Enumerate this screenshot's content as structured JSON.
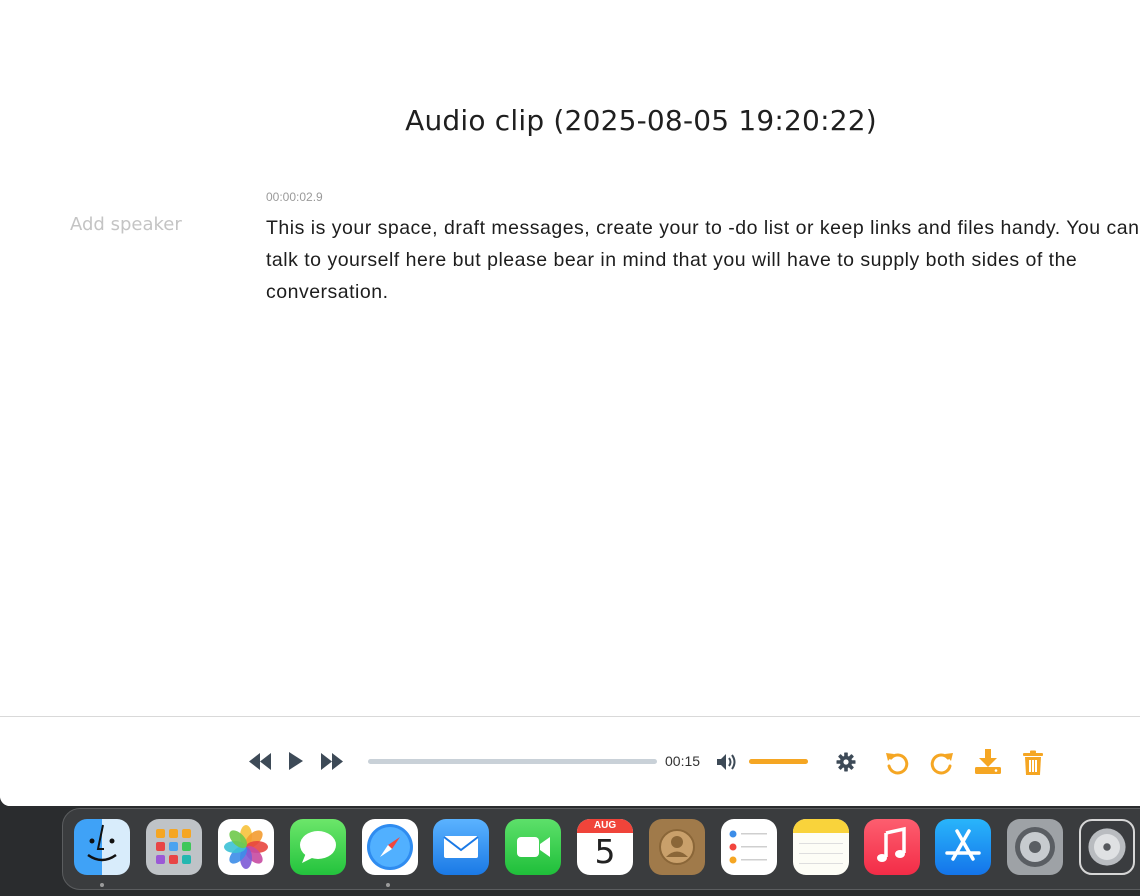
{
  "clip": {
    "title": "Audio clip (2025-08-05 19:20:22)"
  },
  "segment": {
    "speaker_placeholder": "Add speaker",
    "timestamp": "00:00:02.9",
    "text": "This is your space, draft messages, create your to -do list or keep links and files handy. You can talk to yourself here but please bear in mind that you will have to supply both sides of the conversation."
  },
  "player": {
    "time": "00:15",
    "progress": 0,
    "volume": 1.0,
    "accent_color": "#f5a623",
    "icons": [
      "rewind-icon",
      "play-icon",
      "fast-forward-icon",
      "volume-icon",
      "gear-icon",
      "undo-icon",
      "redo-icon",
      "download-icon",
      "trash-icon"
    ]
  },
  "dock": {
    "calendar": {
      "month": "AUG",
      "day": "5"
    },
    "apps": [
      "finder",
      "launchpad",
      "photos",
      "messages",
      "safari",
      "mail",
      "facetime",
      "calendar",
      "contacts",
      "reminders",
      "notes",
      "music",
      "app-store",
      "system-settings",
      "disk-utility"
    ]
  }
}
